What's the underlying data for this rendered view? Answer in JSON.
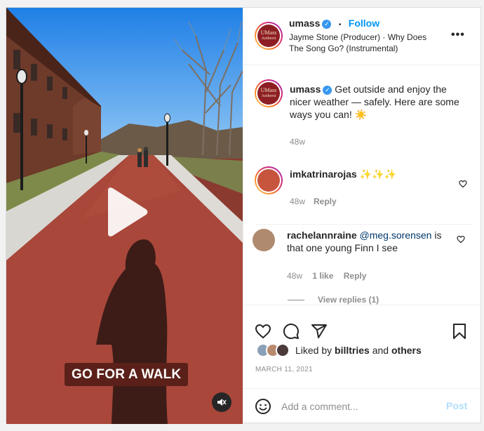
{
  "post": {
    "username": "umass",
    "follow_label": "Follow",
    "dot": "•",
    "audio_line1": "Jayme Stone (Producer) · Why Does",
    "audio_line2": "The Song Go? (Instrumental)",
    "more_label": "•••",
    "avatar_text_1": "UMass",
    "avatar_text_2": "Amherst"
  },
  "video": {
    "caption": "GO FOR A WALK",
    "colors": {
      "path": "#a9473b",
      "sky": "#2f8ef0"
    }
  },
  "comments": [
    {
      "username": "umass",
      "text": "Get outside and enjoy the nicer weather — safely. Here are some ways you can! ☀️",
      "time": "48w"
    },
    {
      "username": "imkatrinarojas",
      "text": "✨✨✨",
      "time": "48w",
      "reply_label": "Reply"
    },
    {
      "username": "rachelannraine",
      "mention": "@meg.sorensen",
      "text": " is that one young Finn I see",
      "time": "48w",
      "likes": "1 like",
      "reply_label": "Reply",
      "view_replies": "View replies (1)"
    }
  ],
  "likes": {
    "prefix": "Liked by ",
    "user": "billtries",
    "middle": " and ",
    "others": "others"
  },
  "date": "MARCH 11, 2021",
  "add_comment": {
    "placeholder": "Add a comment...",
    "post_label": "Post"
  },
  "icons": [
    "play-icon",
    "mute-icon",
    "heart-icon",
    "comment-icon",
    "share-icon",
    "bookmark-icon",
    "emoji-icon",
    "verified-icon"
  ]
}
